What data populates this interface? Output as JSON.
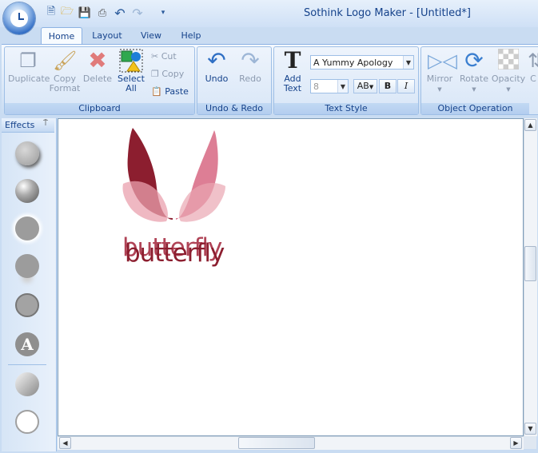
{
  "app": {
    "title": "Sothink Logo Maker - [Untitled*]"
  },
  "quick_access": [
    "new-icon",
    "open-icon",
    "save-icon",
    "print-icon",
    "undo-icon",
    "redo-icon",
    "customize-icon"
  ],
  "tabs": [
    {
      "label": "Home",
      "active": true
    },
    {
      "label": "Layout",
      "active": false
    },
    {
      "label": "View",
      "active": false
    },
    {
      "label": "Help",
      "active": false
    }
  ],
  "clipboard": {
    "group_label": "Clipboard",
    "duplicate": "Duplicate",
    "copy_format_1": "Copy",
    "copy_format_2": "Format",
    "delete": "Delete",
    "select_all_1": "Select",
    "select_all_2": "All",
    "cut": "Cut",
    "copy": "Copy",
    "paste": "Paste"
  },
  "undo_redo": {
    "group_label": "Undo & Redo",
    "undo": "Undo",
    "redo": "Redo"
  },
  "text_style": {
    "group_label": "Text Style",
    "add_text_1": "Add",
    "add_text_2": "Text",
    "font_value": "A Yummy Apology",
    "size_value": "8",
    "bold": "B",
    "italic": "I",
    "spacing": "AB"
  },
  "object_operation": {
    "group_label": "Object Operation",
    "mirror": "Mirror",
    "rotate": "Rotate",
    "opacity": "Opacity",
    "more": "C"
  },
  "effects": {
    "title": "Effects",
    "pin": "⍑",
    "items": [
      "effect-shadow",
      "effect-bevel",
      "effect-glow",
      "effect-reflection",
      "effect-outline",
      "effect-text",
      "effect-gradient",
      "effect-ring"
    ]
  },
  "canvas": {
    "logo_text": "butterfly",
    "logo_color": "#8c1e2f",
    "wing_color_dark": "#8c1e2f",
    "wing_color_light": "#d9708a"
  },
  "colors": {
    "ribbon_bg": "#dbe8f8",
    "accent": "#15428b"
  }
}
